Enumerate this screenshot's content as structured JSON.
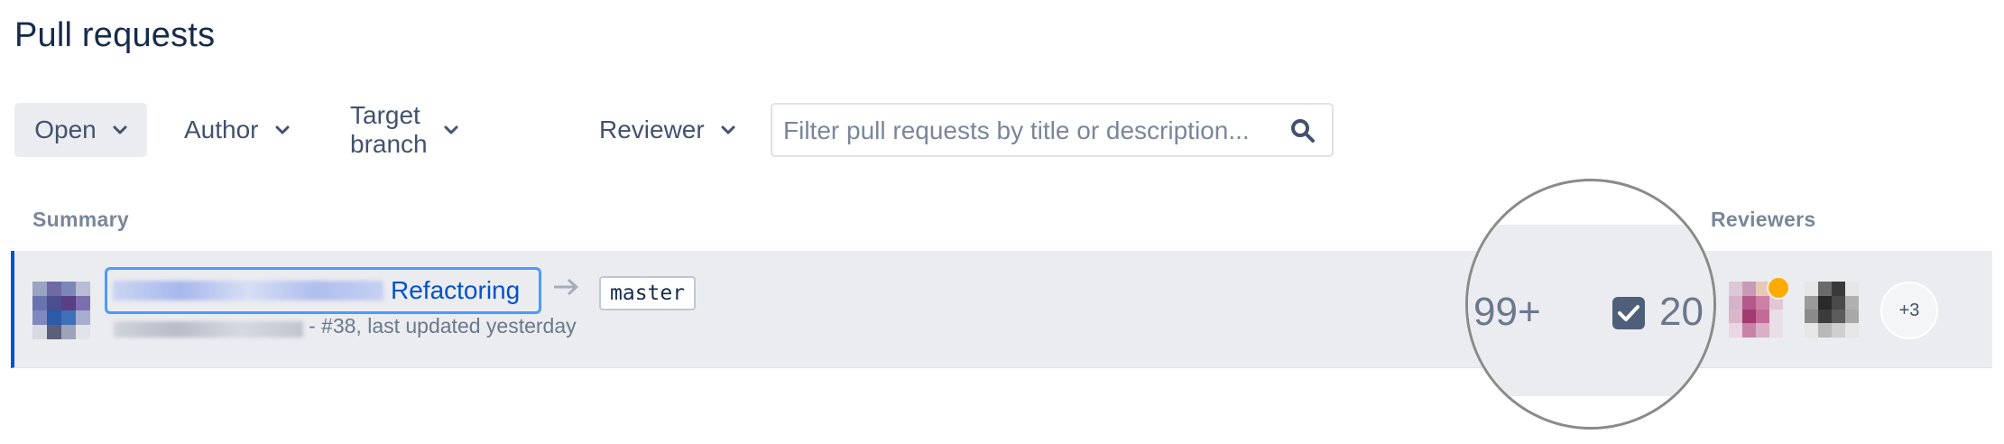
{
  "page": {
    "title": "Pull requests"
  },
  "filters": {
    "state": "Open",
    "author": "Author",
    "target_branch": "Target branch",
    "reviewer": "Reviewer"
  },
  "search": {
    "placeholder": "Filter pull requests by title or description...",
    "value": ""
  },
  "columns": {
    "summary": "Summary",
    "reviewers": "Reviewers"
  },
  "pull_request": {
    "title_visible": "Refactoring",
    "target_branch": "master",
    "meta": "- #38, last updated yesterday",
    "comments_count": "99+",
    "tasks_count": "20",
    "reviewers_more": "+3"
  },
  "colors": {
    "accent": "#0052CC",
    "selection": "#4C9AFF",
    "row_background": "#EBECF0",
    "reviewer_status": "#FFAB00"
  },
  "icons": [
    "chevron-down-icon",
    "search-icon",
    "arrow-right-icon",
    "task-checkbox-icon"
  ]
}
